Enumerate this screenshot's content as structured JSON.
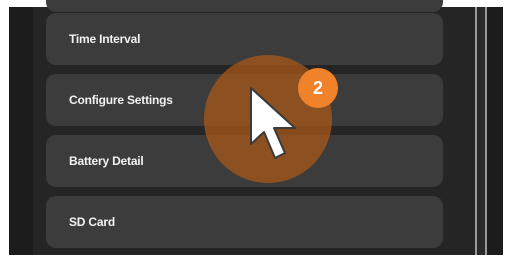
{
  "menu": {
    "items": [
      {
        "label": ""
      },
      {
        "label": "Time Interval"
      },
      {
        "label": "Configure Settings"
      },
      {
        "label": "Battery Detail"
      },
      {
        "label": "SD Card"
      }
    ]
  },
  "overlay": {
    "step_number": "2",
    "highlight_color": "#a85818",
    "badge_color": "#f0832a",
    "cursor_icon": "arrow-pointer-icon"
  }
}
